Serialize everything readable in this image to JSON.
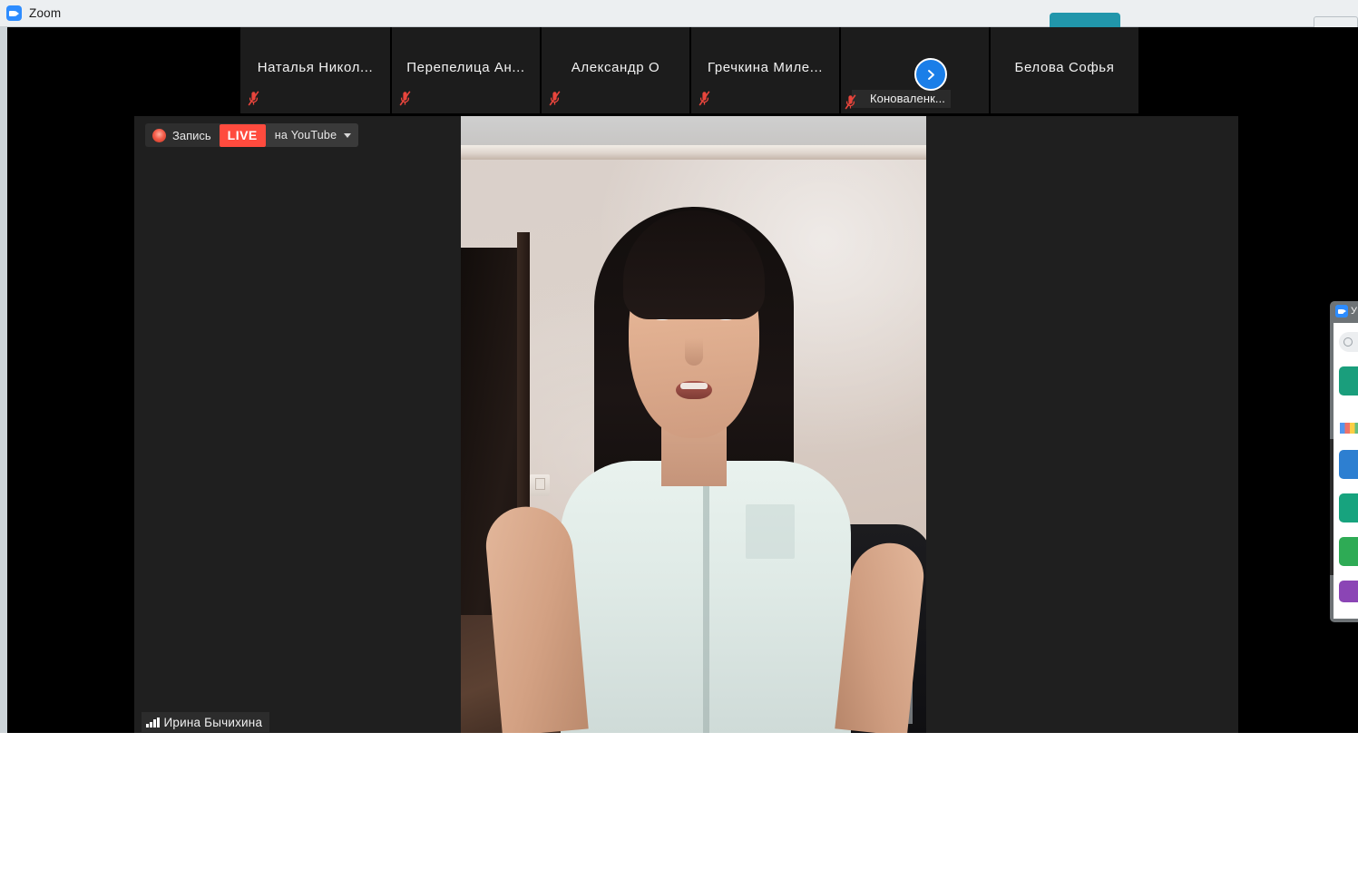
{
  "window": {
    "title": "Zoom",
    "icon": "zoom-camera-icon",
    "accent_blue": "#2d8cff",
    "teal_button_color": "#2196ab",
    "titlebar_bg": "#eceff1"
  },
  "filmstrip": {
    "participants": [
      {
        "name": "Наталья  Никол...",
        "muted": true,
        "label_position": "center"
      },
      {
        "name": "Перепелица  Ан...",
        "muted": true,
        "label_position": "center"
      },
      {
        "name": "Александр О",
        "muted": true,
        "label_position": "center"
      },
      {
        "name": "Гречкина  Миле...",
        "muted": true,
        "label_position": "center"
      },
      {
        "name": "Коноваленк...",
        "muted": true,
        "label_position": "bottom-left"
      },
      {
        "name": "Белова Софья",
        "muted": false,
        "label_position": "center"
      }
    ],
    "next_button": {
      "icon": "chevron-right-icon",
      "color": "#1a7ee8"
    }
  },
  "recording": {
    "dot_icon": "record-dot-icon",
    "label": "Запись",
    "live_badge": "LIVE",
    "live_color": "#ff4b3e",
    "destination": "на YouTube",
    "caret_icon": "chevron-down-icon"
  },
  "speaker": {
    "name": "Ирина Бычихина",
    "signal_icon": "signal-bars-icon",
    "video_alt": "woman with dark hair and bangs in a white blouse on a video call"
  },
  "side_window": {
    "title": "У",
    "icon": "zoom-camera-icon",
    "search_icon": "search-icon",
    "buttons": [
      {
        "name": "side-button-1",
        "color": "#1a9e7c"
      },
      {
        "name": "side-button-2",
        "color": "#2d7fd1"
      },
      {
        "name": "side-button-3",
        "color": "#17a37e"
      },
      {
        "name": "side-button-4",
        "color": "#2eab55"
      },
      {
        "name": "side-button-5",
        "color": "#8b45b5"
      }
    ]
  }
}
